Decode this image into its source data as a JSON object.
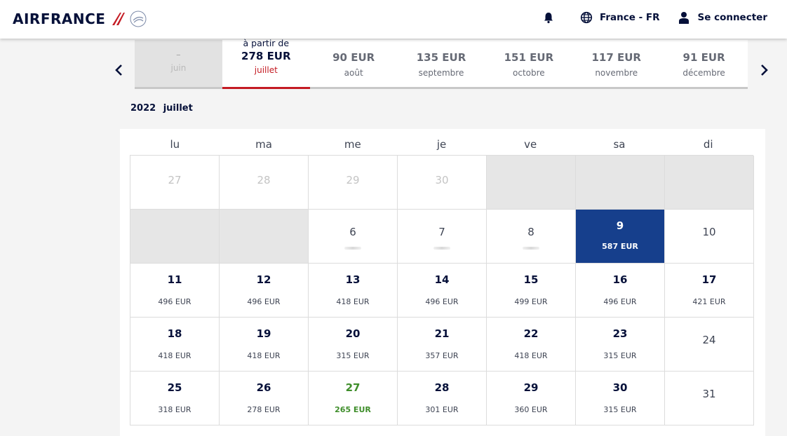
{
  "header": {
    "logo_text": "AIRFRANCE",
    "country_label": "France - FR",
    "login_label": "Se connecter"
  },
  "month_strip": {
    "from_label": "à partir de",
    "months": [
      {
        "price": "–",
        "name": "juin",
        "state": "disabled"
      },
      {
        "price": "278 EUR",
        "name": "juillet",
        "state": "active"
      },
      {
        "price": "90 EUR",
        "name": "août",
        "state": "normal"
      },
      {
        "price": "135 EUR",
        "name": "septembre",
        "state": "normal"
      },
      {
        "price": "151 EUR",
        "name": "octobre",
        "state": "normal"
      },
      {
        "price": "117 EUR",
        "name": "novembre",
        "state": "normal"
      },
      {
        "price": "91 EUR",
        "name": "décembre",
        "state": "normal"
      }
    ]
  },
  "calendar": {
    "year": "2022",
    "month": "juillet",
    "weekdays": [
      "lu",
      "ma",
      "me",
      "je",
      "ve",
      "sa",
      "di"
    ],
    "cells": [
      {
        "day": "27",
        "type": "other"
      },
      {
        "day": "28",
        "type": "other"
      },
      {
        "day": "29",
        "type": "other"
      },
      {
        "day": "30",
        "type": "other"
      },
      {
        "day": "",
        "type": "grey"
      },
      {
        "day": "",
        "type": "grey"
      },
      {
        "day": "",
        "type": "grey"
      },
      {
        "day": "",
        "type": "grey"
      },
      {
        "day": "",
        "type": "grey"
      },
      {
        "day": "6",
        "type": "loading"
      },
      {
        "day": "7",
        "type": "loading"
      },
      {
        "day": "8",
        "type": "loading"
      },
      {
        "day": "9",
        "price": "587 EUR",
        "type": "selected"
      },
      {
        "day": "10",
        "type": "noprice"
      },
      {
        "day": "11",
        "price": "496 EUR",
        "type": "price"
      },
      {
        "day": "12",
        "price": "496 EUR",
        "type": "price"
      },
      {
        "day": "13",
        "price": "418 EUR",
        "type": "price"
      },
      {
        "day": "14",
        "price": "496 EUR",
        "type": "price"
      },
      {
        "day": "15",
        "price": "499 EUR",
        "type": "price"
      },
      {
        "day": "16",
        "price": "496 EUR",
        "type": "price"
      },
      {
        "day": "17",
        "price": "421 EUR",
        "type": "price"
      },
      {
        "day": "18",
        "price": "418 EUR",
        "type": "price"
      },
      {
        "day": "19",
        "price": "418 EUR",
        "type": "price"
      },
      {
        "day": "20",
        "price": "315 EUR",
        "type": "price"
      },
      {
        "day": "21",
        "price": "357 EUR",
        "type": "price"
      },
      {
        "day": "22",
        "price": "418 EUR",
        "type": "price"
      },
      {
        "day": "23",
        "price": "315 EUR",
        "type": "price"
      },
      {
        "day": "24",
        "type": "noprice"
      },
      {
        "day": "25",
        "price": "318 EUR",
        "type": "price"
      },
      {
        "day": "26",
        "price": "278 EUR",
        "type": "price"
      },
      {
        "day": "27",
        "price": "265 EUR",
        "type": "cheapest"
      },
      {
        "day": "28",
        "price": "301 EUR",
        "type": "price"
      },
      {
        "day": "29",
        "price": "360 EUR",
        "type": "price"
      },
      {
        "day": "30",
        "price": "315 EUR",
        "type": "price"
      },
      {
        "day": "31",
        "type": "noprice"
      }
    ]
  },
  "colors": {
    "brand_navy": "#051039",
    "selected_blue": "#163f8c",
    "accent_red": "#c41b23",
    "cheapest_green": "#3f8e2b"
  }
}
